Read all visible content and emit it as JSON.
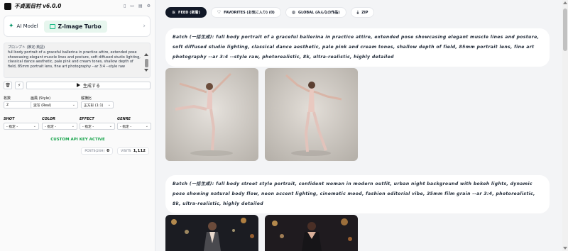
{
  "app": {
    "title": "不貞面目村 v6.0.0",
    "header_icons": [
      "book-icon",
      "copy-icon",
      "document-icon",
      "gear-icon"
    ]
  },
  "model": {
    "ai_model_label": "AI Model",
    "selected_model": "Z-Image Turbo"
  },
  "prompt": {
    "label": "プロンプト (推定:英語)",
    "value": "full body portrait of a graceful ballerina in practice attire, extended pose showcasing elegant muscle lines and posture, soft diffused studio lighting, classical dance aesthetic, pale pink and cream tones, shallow depth of field, 85mm portrait lens, fine art photography --ar 3:4 --style raw"
  },
  "actions": {
    "delete_icon": "trash-icon",
    "flash_icon": "lightning-icon",
    "generate_label": "生成する"
  },
  "settings": {
    "count": {
      "label": "枚数",
      "value": "2"
    },
    "style": {
      "label": "画風 (Style)",
      "value": "実写 (Real)"
    },
    "ratio": {
      "label": "縦横比",
      "value": "正方形 (1:1)"
    },
    "shot": {
      "label": "SHOT",
      "value": "- 指定 -"
    },
    "color": {
      "label": "COLOR",
      "value": "- 指定 -"
    },
    "effect": {
      "label": "EFFECT",
      "value": "- 指定 -"
    },
    "genre": {
      "label": "GENRE",
      "value": "- 指定 -"
    }
  },
  "status": {
    "api_key": "CUSTOM API KEY ACTIVE",
    "posts_label": "POSTS(24H)",
    "posts_value": "0",
    "visits_label": "VISITS",
    "visits_value": "1,112"
  },
  "tabs": [
    {
      "label": "FEED (新着)",
      "icon": "layers-icon"
    },
    {
      "label": "FAVORITES (お気に入り) (0)",
      "icon": "heart-icon"
    },
    {
      "label": "GLOBAL (みんなの作品)",
      "icon": "globe-icon"
    },
    {
      "label": "ZIP",
      "icon": "download-icon"
    }
  ],
  "feed": [
    {
      "text": "Batch (一括生成): full body portrait of a graceful ballerina in practice attire, extended pose showcasing elegant muscle lines and posture, soft diffused studio lighting, classical dance aesthetic, pale pink and cream tones, shallow depth of field, 85mm portrait lens, fine art photography --ar 3:4 --style raw, photorealistic, 8k, ultra-realistic, highly detailed"
    },
    {
      "text": "Batch (一括生成): full body street style portrait, confident woman in modern outfit, urban night background with bokeh lights, dynamic pose showing natural body flow, neon accent lighting, cinematic mood, fashion editorial vibe, 35mm film grain --ar 3:4, photorealistic, 8k, ultra-realistic, highly detailed"
    }
  ],
  "colors": {
    "accent_green": "#16a34a",
    "tab_active_bg": "#111827"
  }
}
